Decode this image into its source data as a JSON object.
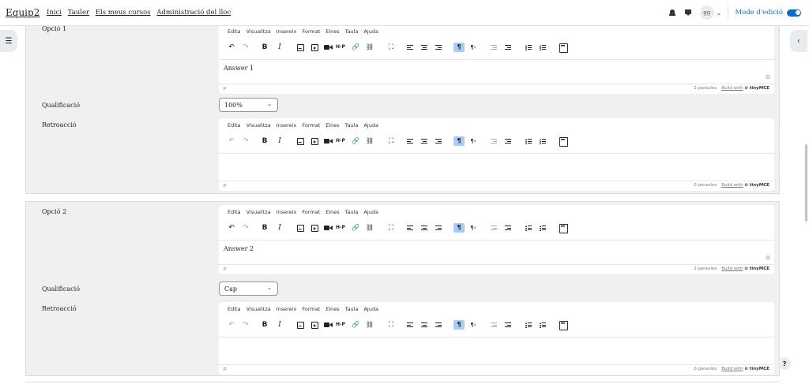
{
  "navbar": {
    "brand": "Equip2",
    "links": [
      "Inici",
      "Tauler",
      "Els meus cursos",
      "Administració del lloc"
    ],
    "avatar_initials": "gg",
    "dropdown_caret": "⌄",
    "edit_mode_label": "Mode d'edició",
    "edit_mode_on": true
  },
  "drawers": {
    "left_icon": "☰",
    "right_icon": "‹"
  },
  "editor_menu": [
    "Edita",
    "Visualitza",
    "Insereix",
    "Format",
    "Eines",
    "Taula",
    "Ajuda"
  ],
  "icons": {
    "undo": "↶",
    "redo": "↷",
    "bold": "B",
    "italic": "I",
    "h5p": "H-P",
    "link": "🔗",
    "unlink": "⛓",
    "fullscreen": "⛶",
    "ltr": "¶",
    "rtl": "¶‹",
    "gear": "⚙"
  },
  "statusbar": {
    "path": "p",
    "build_with": "Build with",
    "tinymce": "⊘ tinyMCE"
  },
  "options": [
    {
      "label": "Opció 1",
      "answer": "Answer 1",
      "answer_words": "2 paraules",
      "grade_label": "Qualificació",
      "grade_value": "100%",
      "feedback_label": "Retroacció",
      "feedback_words": "0 paraules"
    },
    {
      "label": "Opció 2",
      "answer": "Answer 2",
      "answer_words": "2 paraules",
      "grade_label": "Qualificació",
      "grade_value": "Cap",
      "feedback_label": "Retroacció",
      "feedback_words": "0 paraules"
    }
  ],
  "help_button": "?",
  "colors": {
    "accent": "#0f6cbf",
    "group_bg": "#f0f0f0",
    "active_tool": "#a6ccf7"
  }
}
